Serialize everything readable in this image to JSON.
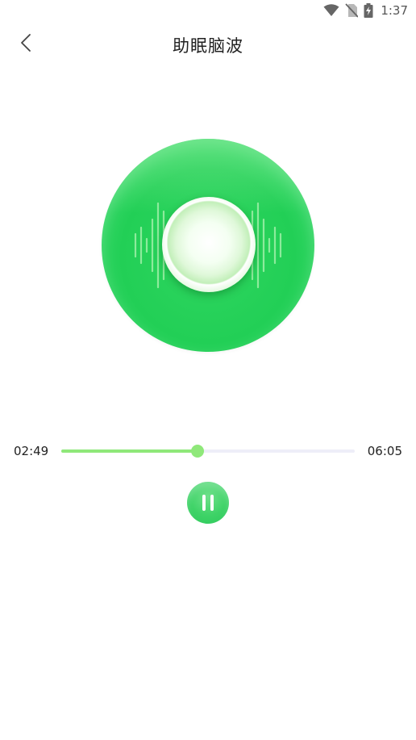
{
  "status_bar": {
    "time": "1:37",
    "icons": [
      "wifi-icon",
      "no-sim-icon",
      "battery-charging-icon"
    ]
  },
  "header": {
    "back_icon": "chevron-left-icon",
    "title": "助眠脑波"
  },
  "player": {
    "current_time": "02:49",
    "total_time": "06:05",
    "progress": 0.463,
    "state": "playing",
    "pause_icon": "pause-icon"
  },
  "colors": {
    "accent": "#8fe87a",
    "disc_green": "#22cf56",
    "track": "#eeeef8"
  }
}
